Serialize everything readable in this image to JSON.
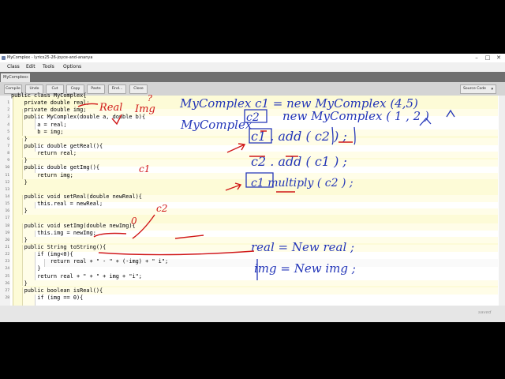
{
  "window": {
    "title": "MyComplex - lyrics25-26-joyce-and-ananya"
  },
  "menu": [
    "Class",
    "Edit",
    "Tools",
    "Options"
  ],
  "tab": {
    "label": "MyComplex",
    "close": "x"
  },
  "toolbar": {
    "buttons": [
      "Compile",
      "Undo",
      "Cut",
      "Copy",
      "Paste",
      "Find...",
      "Close"
    ],
    "view_select": "Source Code"
  },
  "code": {
    "line_numbers": [
      "1",
      "2",
      "3",
      "4",
      "5",
      "6",
      "7",
      "8",
      "9",
      "10",
      "11",
      "12",
      "13",
      "14",
      "15",
      "16",
      "17",
      "18",
      "19",
      "20",
      "21",
      "22",
      "23",
      "24",
      "25",
      "26",
      "27",
      "28"
    ],
    "lines": [
      "public class MyComplex{",
      "    private double real;",
      "    private double img;",
      "    public MyComplex(double a, double b){",
      "        a = real;",
      "        b = img;",
      "    }",
      "    public double getReal(){",
      "        return real;",
      "    }",
      "    public double getImg(){",
      "        return img;",
      "    }",
      "",
      "    public void setReal(double newReal){",
      "        this.real = newReal;",
      "    }",
      "",
      "    public void setImg(double newImg){",
      "        this.img = newImg;",
      "    }",
      "    public String toString(){",
      "        if (img<0){",
      "            return real + \" - \" + (-img) + \" i\";",
      "        }",
      "        return real + \" + \" + img + \"i\";",
      "    }",
      "    public boolean isReal(){",
      "        if (img == 0){"
    ]
  },
  "annotations": {
    "line1": "MyComplex c1 = new MyComplex (4,5)",
    "line2a": "MyComplex",
    "line2b": "c2",
    "line2c": "new MyComplex ( 1 , 2 )",
    "add1": "c1 . add ( c2 ) ;",
    "add2": "c2 . add ( c1 ) ;",
    "mult": "c1 multiply ( c2 ) ;",
    "real_assign": "real = New real ;",
    "img_assign": "img = New img ;",
    "margin_real": "Real",
    "margin_img": "Img",
    "margin_q": "?",
    "margin_c1": "c1",
    "margin_c2": "c2",
    "margin_zero": "0"
  },
  "status": {
    "saved": "saved"
  }
}
